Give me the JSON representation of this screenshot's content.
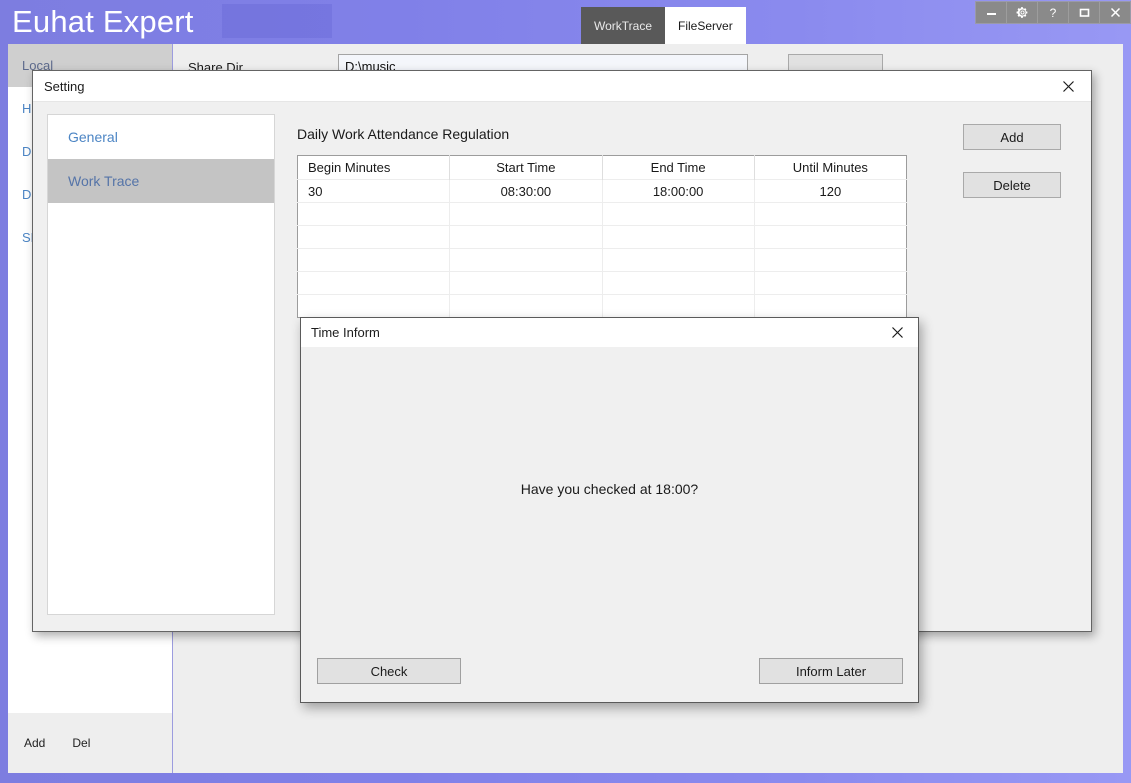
{
  "app": {
    "title": "Euhat Expert",
    "accent_color": "#8080e8",
    "tabs": [
      {
        "label": "WorkTrace",
        "active": false
      },
      {
        "label": "FileServer",
        "active": true
      }
    ],
    "window_controls": [
      {
        "name": "minimize",
        "glyph": "—"
      },
      {
        "name": "settings-gear",
        "glyph": "⚙"
      },
      {
        "name": "help",
        "glyph": "?"
      },
      {
        "name": "maximize",
        "glyph": "□"
      },
      {
        "name": "close",
        "glyph": "✕"
      }
    ]
  },
  "sidebar": {
    "items": [
      {
        "label": "Local",
        "selected": true
      },
      {
        "label": "HU",
        "selected": false
      },
      {
        "label": "DE",
        "selected": false
      },
      {
        "label": "DE",
        "selected": false
      },
      {
        "label": "SM",
        "selected": false
      }
    ],
    "footer": {
      "add_label": "Add",
      "del_label": "Del"
    }
  },
  "file_server": {
    "share_dir_label": "Share Dir",
    "share_dir_value": "D:\\music",
    "browse_button_label": ""
  },
  "setting_dialog": {
    "title": "Setting",
    "close_label": "✕",
    "nav": [
      {
        "label": "General",
        "selected": false
      },
      {
        "label": "Work Trace",
        "selected": true
      }
    ],
    "section_title": "Daily Work Attendance Regulation",
    "table": {
      "columns": [
        "Begin Minutes",
        "Start Time",
        "End Time",
        "Until Minutes"
      ],
      "rows": [
        [
          "30",
          "08:30:00",
          "18:00:00",
          "120"
        ],
        [
          "",
          "",
          "",
          ""
        ],
        [
          "",
          "",
          "",
          ""
        ],
        [
          "",
          "",
          "",
          ""
        ],
        [
          "",
          "",
          "",
          ""
        ],
        [
          "",
          "",
          "",
          ""
        ]
      ]
    },
    "add_button_label": "Add",
    "delete_button_label": "Delete"
  },
  "time_inform_dialog": {
    "title": "Time Inform",
    "close_label": "✕",
    "message": "Have you checked at 18:00?",
    "check_button_label": "Check",
    "later_button_label": "Inform Later"
  }
}
